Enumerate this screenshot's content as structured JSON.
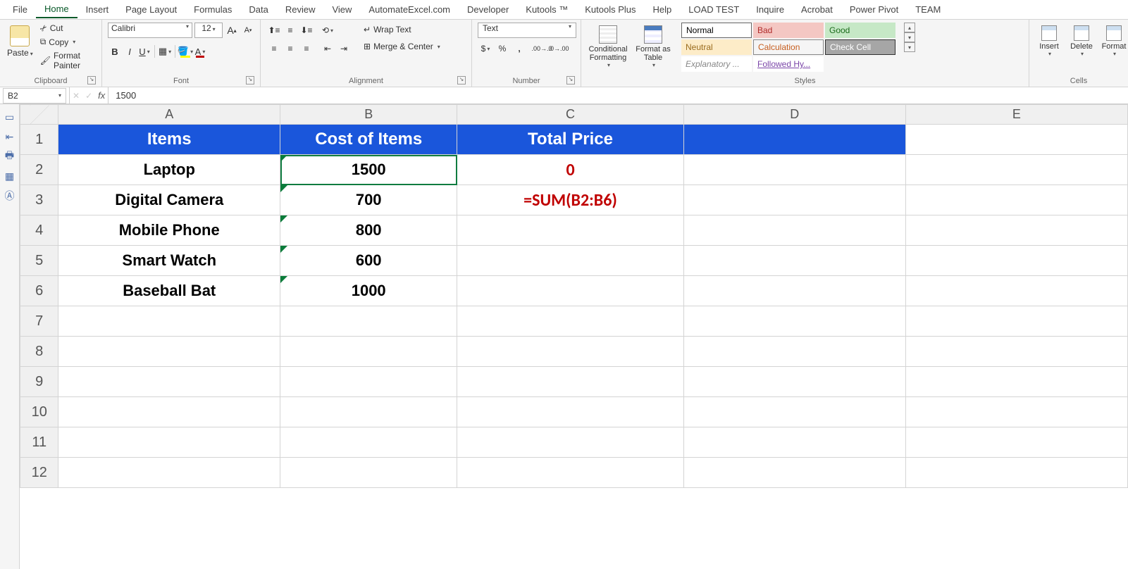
{
  "menu": {
    "items": [
      "File",
      "Home",
      "Insert",
      "Page Layout",
      "Formulas",
      "Data",
      "Review",
      "View",
      "AutomateExcel.com",
      "Developer",
      "Kutools ™",
      "Kutools Plus",
      "Help",
      "LOAD TEST",
      "Inquire",
      "Acrobat",
      "Power Pivot",
      "TEAM"
    ],
    "active": "Home"
  },
  "clipboard": {
    "paste": "Paste",
    "cut": "Cut",
    "copy": "Copy",
    "fp": "Format Painter",
    "label": "Clipboard"
  },
  "font": {
    "name": "Calibri",
    "size": "12",
    "label": "Font"
  },
  "alignment": {
    "wrap": "Wrap Text",
    "merge": "Merge & Center",
    "label": "Alignment"
  },
  "number": {
    "format": "Text",
    "label": "Number"
  },
  "styles": {
    "cond": "Conditional Formatting",
    "fat": "Format as Table",
    "label": "Styles",
    "gallery": [
      {
        "cls": "normal",
        "label": "Normal"
      },
      {
        "cls": "bad",
        "label": "Bad"
      },
      {
        "cls": "good",
        "label": "Good"
      },
      {
        "cls": "neutral",
        "label": "Neutral"
      },
      {
        "cls": "calc",
        "label": "Calculation"
      },
      {
        "cls": "check",
        "label": "Check Cell"
      },
      {
        "cls": "expl",
        "label": "Explanatory ..."
      },
      {
        "cls": "follow",
        "label": "Followed Hy..."
      }
    ]
  },
  "cells": {
    "insert": "Insert",
    "delete": "Delete",
    "format": "Format",
    "label": "Cells"
  },
  "formulaBar": {
    "nameBox": "B2",
    "value": "1500"
  },
  "sheet": {
    "columns": [
      "A",
      "B",
      "C",
      "D",
      "E"
    ],
    "rows": [
      {
        "n": "1",
        "hdr": true,
        "A": "Items",
        "B": "Cost of Items",
        "C": "Total Price",
        "D": ""
      },
      {
        "n": "2",
        "A": "Laptop",
        "B": "1500",
        "C": "0",
        "Bsel": true,
        "Cc": "redbold",
        "err": true
      },
      {
        "n": "3",
        "A": "Digital Camera",
        "B": "700",
        "C": "=SUM(B2:B6)",
        "Cc": "redbold",
        "err": true
      },
      {
        "n": "4",
        "A": "Mobile Phone",
        "B": "800",
        "C": "",
        "err": true
      },
      {
        "n": "5",
        "A": "Smart Watch",
        "B": "600",
        "C": "",
        "err": true
      },
      {
        "n": "6",
        "A": "Baseball Bat",
        "B": "1000",
        "C": "",
        "err": true
      },
      {
        "n": "7"
      },
      {
        "n": "8"
      },
      {
        "n": "9"
      },
      {
        "n": "10"
      },
      {
        "n": "11"
      },
      {
        "n": "12"
      }
    ]
  }
}
